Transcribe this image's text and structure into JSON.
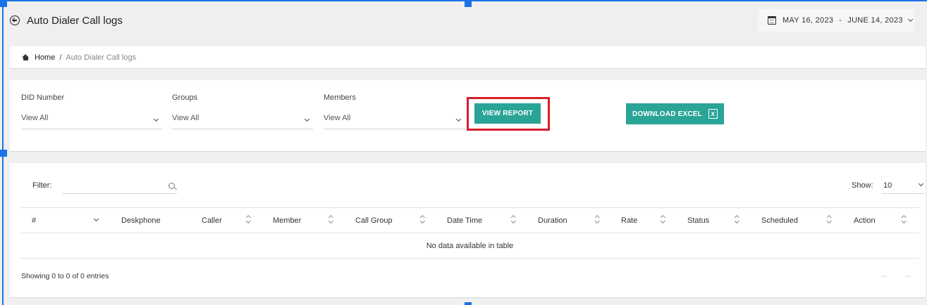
{
  "header": {
    "title": "Auto Dialer Call logs",
    "date_start": "MAY 16, 2023",
    "date_separator": "-",
    "date_end": "JUNE 14, 2023"
  },
  "breadcrumb": {
    "home": "Home",
    "separator": "/",
    "current": "Auto Dialer Call logs"
  },
  "filters": {
    "did_number": {
      "label": "DID Number",
      "value": "View All"
    },
    "groups": {
      "label": "Groups",
      "value": "View All"
    },
    "members": {
      "label": "Members",
      "value": "View All"
    },
    "view_report_label": "VIEW REPORT",
    "download_excel_label": "DOWNLOAD EXCEL",
    "excel_icon_glyph": "X"
  },
  "table": {
    "filter_label": "Filter:",
    "filter_value": "",
    "show_label": "Show:",
    "show_value": "10",
    "columns": [
      "#",
      "Deskphone",
      "Caller",
      "Member",
      "Call Group",
      "Date Time",
      "Duration",
      "Rate",
      "Status",
      "Scheduled",
      "Action"
    ],
    "empty_message": "No data available in table",
    "info": "Showing 0 to 0 of 0 entries",
    "prev_glyph": "←",
    "next_glyph": "→"
  },
  "colors": {
    "accent": "#2aa497",
    "highlight": "#d61f2a",
    "selection": "#1a73e8"
  },
  "icons": [
    "back-arrow-icon",
    "calendar-icon",
    "chevron-down-icon",
    "home-icon",
    "search-icon",
    "excel-icon",
    "sort-icon"
  ]
}
